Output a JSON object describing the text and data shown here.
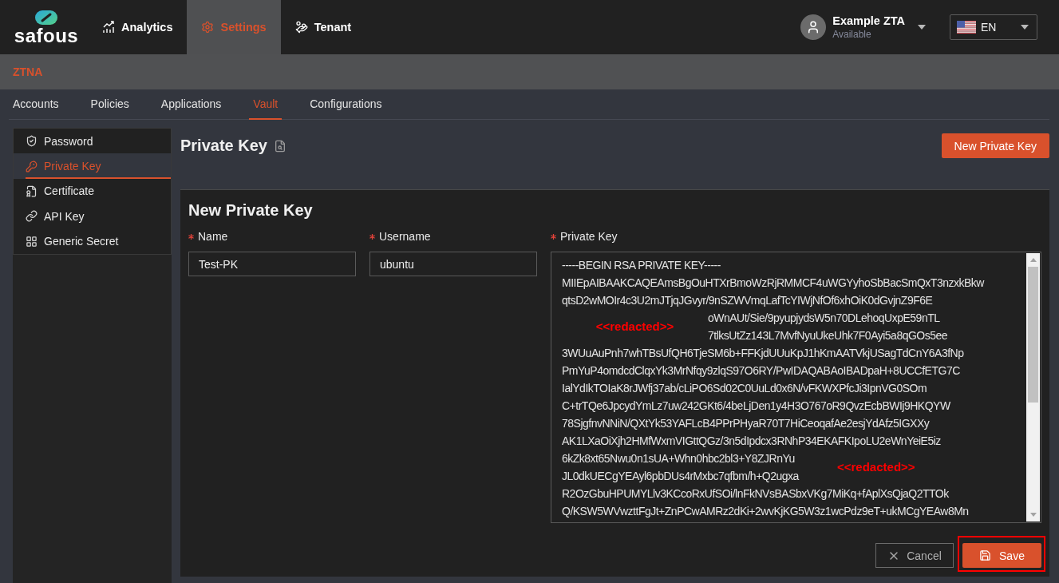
{
  "brand": {
    "name": "safous"
  },
  "nav": [
    {
      "label": "Analytics",
      "selected": false
    },
    {
      "label": "Settings",
      "selected": true
    },
    {
      "label": "Tenant",
      "selected": false
    }
  ],
  "user": {
    "name": "Example ZTA",
    "status": "Available"
  },
  "language": {
    "value": "EN"
  },
  "section": {
    "title": "ZTNA"
  },
  "tabs": [
    {
      "label": "Accounts",
      "selected": false
    },
    {
      "label": "Policies",
      "selected": false
    },
    {
      "label": "Applications",
      "selected": false
    },
    {
      "label": "Vault",
      "selected": true
    },
    {
      "label": "Configurations",
      "selected": false
    }
  ],
  "sidebar": {
    "items": [
      {
        "label": "Password",
        "selected": false
      },
      {
        "label": "Private Key",
        "selected": true
      },
      {
        "label": "Certificate",
        "selected": false
      },
      {
        "label": "API Key",
        "selected": false
      },
      {
        "label": "Generic Secret",
        "selected": false
      }
    ]
  },
  "page": {
    "title": "Private Key",
    "new_button": "New Private Key"
  },
  "form": {
    "title": "New Private Key",
    "fields": [
      {
        "kind": "input",
        "label": "Name",
        "required": true,
        "value": "Test-PK"
      },
      {
        "kind": "input",
        "label": "Username",
        "required": true,
        "value": "ubuntu"
      },
      {
        "kind": "textarea",
        "label": "Private Key",
        "required": true,
        "lines": [
          {
            "kind": "text",
            "text": "-----BEGIN RSA PRIVATE KEY-----"
          },
          {
            "kind": "text",
            "text": "MIIEpAIBAAKCAQEAmsBgOuHTXrBmoWzRjRMMCF4uWGYyhoSbBacSmQxT3nzxkBkw"
          },
          {
            "kind": "text",
            "text": "qtsD2wMOIr4c3U2mJTjqJGvyr/9nSZWVmqLafTcYIWjNfOf6xhOiK0dGvjnZ9F6E"
          },
          {
            "kind": "redacted_start",
            "label": "<<redacted>>",
            "lines": [
              "oWnAUt/Sie/9pyupjydsW5n70DLehoqUxpE59nTL",
              "7tlksUtZz143L7MvfNyuUkeUhk7F0Ayi5a8qGOs5ee"
            ]
          },
          {
            "kind": "text",
            "text": "3WUuAuPnh7whTBsUfQH6TjeSM6b+FFKjdUUuKpJ1hKmAATVkjUSagTdCnY6A3fNp"
          },
          {
            "kind": "text",
            "text": "PmYuP4omdcdClqxYk3MrNfqy9zlqS97O6RY/PwIDAQABAoIBADpaH+8UCCfETG7C"
          },
          {
            "kind": "text",
            "text": "IalYdIkTOIaK8rJWfj37ab/cLiPO6Sd02C0UuLd0x6N/vFKWXPfcJi3IpnVG0SOm"
          },
          {
            "kind": "text",
            "text": "C+trTQe6JpcydYmLz7uw242GKt6/4beLjDen1y4H3O767oR9QvzEcbBWIj9HKQYW"
          },
          {
            "kind": "text",
            "text": "78SjgfnvNNiN/QXtYk53YAFLcB4PPrPHyaR70T7HiCeoqafAe2esjYdAfz5IGXXy"
          },
          {
            "kind": "text",
            "text": "AK1LXaOiXjh2HMfWxmVIGttQGz/3n5dIpdcx3RNhP34EKAFKIpoLU2eWnYeiE5iz"
          },
          {
            "kind": "redacted_end",
            "label": "<<redacted>>",
            "lines": [
              "6kZk8xt65Nwu0n1sUA+Whn0hbc2bl3+Y8ZJRnYu",
              "JL0dkUECgYEAyl6pbDUs4rMxbc7qfbm/h+Q2ugxa"
            ]
          },
          {
            "kind": "text",
            "text": "R2OzGbuHPUMYLlv3KCcoRxUfSOi/lnFkNVsBASbxVKg7MiKq+fAplXsQjaQ2TTOk"
          },
          {
            "kind": "text",
            "text": "Q/KSW5WVwzttFgJt+ZnPCwAMRz2dKi+2wvKjKG5W3z1wcPdz9eT+ukMCgYEAw8Mn"
          }
        ]
      }
    ],
    "cancel": {
      "label": "Cancel"
    },
    "save": {
      "label": "Save",
      "highlighted": true
    }
  }
}
